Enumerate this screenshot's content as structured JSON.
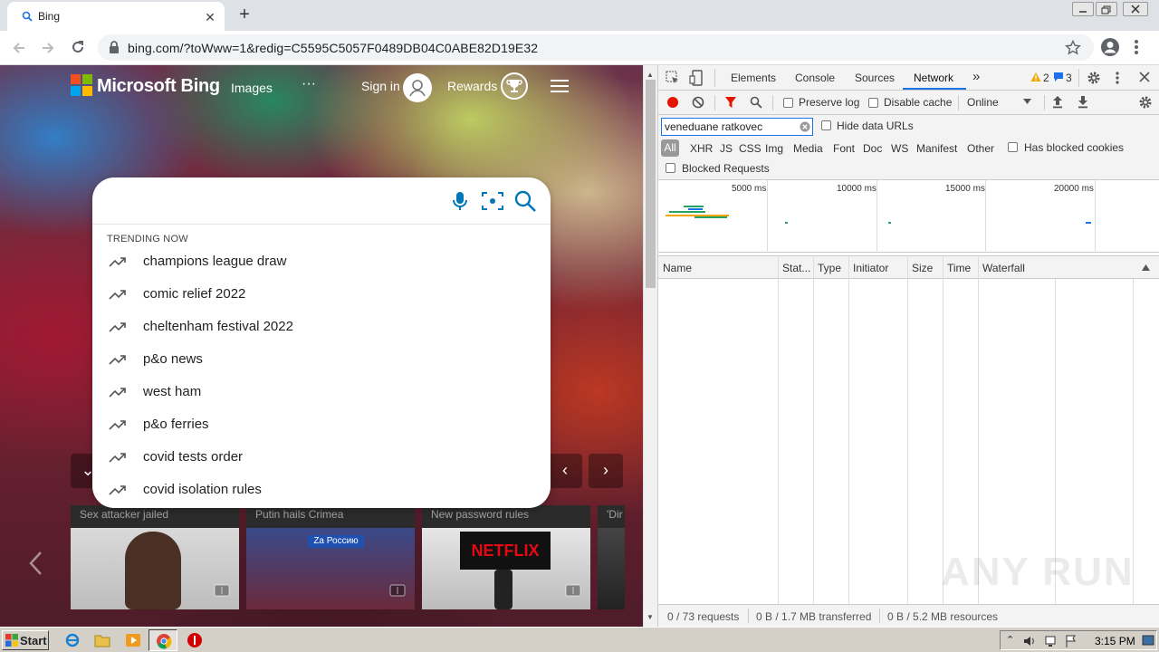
{
  "browser": {
    "tab": {
      "title": "Bing",
      "close": "✕"
    },
    "new_tab": "+",
    "url": "bing.com/?toWww=1&redig=C5595C5057F0489DB04C0ABE82D19E32"
  },
  "bing": {
    "brand": "Microsoft Bing",
    "nav": {
      "images": "Images",
      "more": "···",
      "sign_in": "Sign in",
      "rewards": "Rewards"
    },
    "search": {
      "value": "",
      "trending_label": "TRENDING NOW",
      "trending": [
        "champions league draw",
        "comic relief 2022",
        "cheltenham festival 2022",
        "p&o news",
        "west ham",
        "p&o ferries",
        "covid tests order",
        "covid isolation rules"
      ]
    },
    "news": [
      {
        "caption": "Sex attacker jailed"
      },
      {
        "caption": "Putin hails Crimea",
        "sign": "Za Россию"
      },
      {
        "caption": "New password rules",
        "brand": "NETFLIX"
      },
      {
        "caption": "'Dir"
      }
    ]
  },
  "devtools": {
    "tabs": [
      "Elements",
      "Console",
      "Sources",
      "Network"
    ],
    "active_tab": "Network",
    "more": "»",
    "warnings": "2",
    "messages": "3",
    "toolbar": {
      "preserve_log": "Preserve log",
      "disable_cache": "Disable cache",
      "throttle": "Online"
    },
    "filter": {
      "value": "veneduane ratkovec",
      "hide_data_urls": "Hide data URLs",
      "types": [
        "All",
        "XHR",
        "JS",
        "CSS",
        "Img",
        "Media",
        "Font",
        "Doc",
        "WS",
        "Manifest",
        "Other"
      ],
      "has_blocked_cookies": "Has blocked cookies",
      "blocked_requests": "Blocked Requests"
    },
    "overview_ticks": [
      "5000 ms",
      "10000 ms",
      "15000 ms",
      "20000 ms"
    ],
    "columns": [
      "Name",
      "Stat...",
      "Type",
      "Initiator",
      "Size",
      "Time",
      "Waterfall"
    ],
    "status": {
      "requests": "0 / 73 requests",
      "transferred": "0 B / 1.7 MB transferred",
      "resources": "0 B / 5.2 MB resources"
    },
    "watermark": "ANY RUN"
  },
  "taskbar": {
    "start": "Start",
    "clock": "3:15 PM"
  },
  "colors": {
    "accent": "#1a73e8",
    "bing_blue": "#0078b8",
    "record_red": "#e51400"
  }
}
